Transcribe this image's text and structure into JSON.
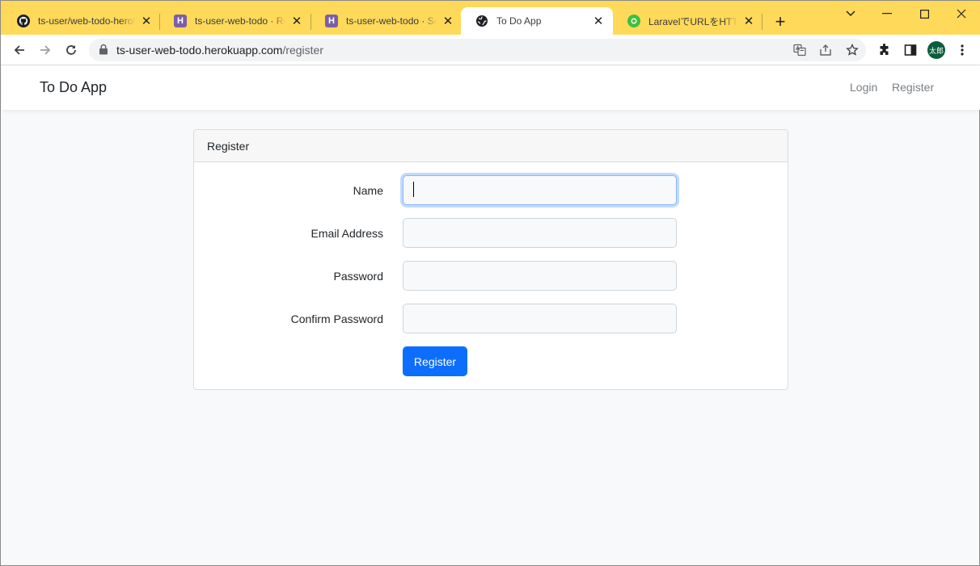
{
  "browser": {
    "tabs": [
      {
        "title": "ts-user/web-todo-heroku",
        "active": false
      },
      {
        "title": "ts-user-web-todo · Resources",
        "active": false
      },
      {
        "title": "ts-user-web-todo · Settings",
        "active": false
      },
      {
        "title": "To Do App",
        "active": true
      },
      {
        "title": "LaravelでURLをHTTPS化",
        "active": false
      }
    ],
    "url_host": "ts-user-web-todo.herokuapp.com",
    "url_path": "/register",
    "profile_label": "太郎",
    "colors": {
      "tabstrip": "#ffd95a",
      "profile": "#0b5d3b"
    }
  },
  "navbar": {
    "brand": "To Do App",
    "links": [
      "Login",
      "Register"
    ]
  },
  "card": {
    "header": "Register",
    "fields": [
      {
        "label": "Name",
        "value": ""
      },
      {
        "label": "Email Address",
        "value": ""
      },
      {
        "label": "Password",
        "value": ""
      },
      {
        "label": "Confirm Password",
        "value": ""
      }
    ],
    "submit_label": "Register",
    "colors": {
      "primary": "#0d6efd",
      "focus": "#86b7fe"
    }
  }
}
